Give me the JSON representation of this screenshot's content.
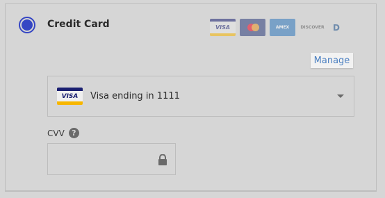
{
  "payment_method": {
    "label": "Credit Card",
    "selected": true
  },
  "brand_icons": [
    {
      "name": "visa-icon",
      "text": "VISA"
    },
    {
      "name": "mastercard-icon",
      "text": ""
    },
    {
      "name": "amex-icon",
      "text": "AMEX"
    },
    {
      "name": "discover-icon",
      "text": "DISCOVER"
    },
    {
      "name": "diners-icon",
      "text": "D"
    }
  ],
  "manage": {
    "label": "Manage"
  },
  "saved_card": {
    "brand_text": "VISA",
    "label": "Visa ending in 1111"
  },
  "cvv": {
    "label": "CVV",
    "help_glyph": "?",
    "value": "",
    "placeholder": ""
  },
  "colors": {
    "accent": "#3546c4",
    "link": "#4a7fc1",
    "background": "#d6d6d6"
  }
}
